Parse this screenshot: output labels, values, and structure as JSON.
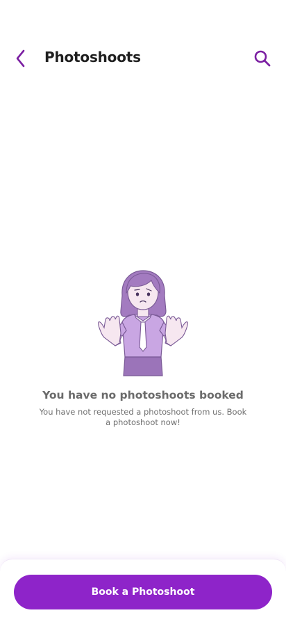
{
  "header": {
    "back_icon": "chevron-left-icon",
    "title": "Photoshoots",
    "search_icon": "search-icon"
  },
  "empty_state": {
    "illustration": "confused-woman-shrug-illustration",
    "title": "You have no photoshoots booked",
    "subtitle": "You have not requested a photoshoot from us. Book a photoshoot now!"
  },
  "footer": {
    "cta_label": "Book a Photoshoot"
  },
  "colors": {
    "accent": "#8e24c9",
    "icon": "#7b1fa2",
    "title_text": "#1f1f1f",
    "muted_text": "#6b6b6b"
  }
}
